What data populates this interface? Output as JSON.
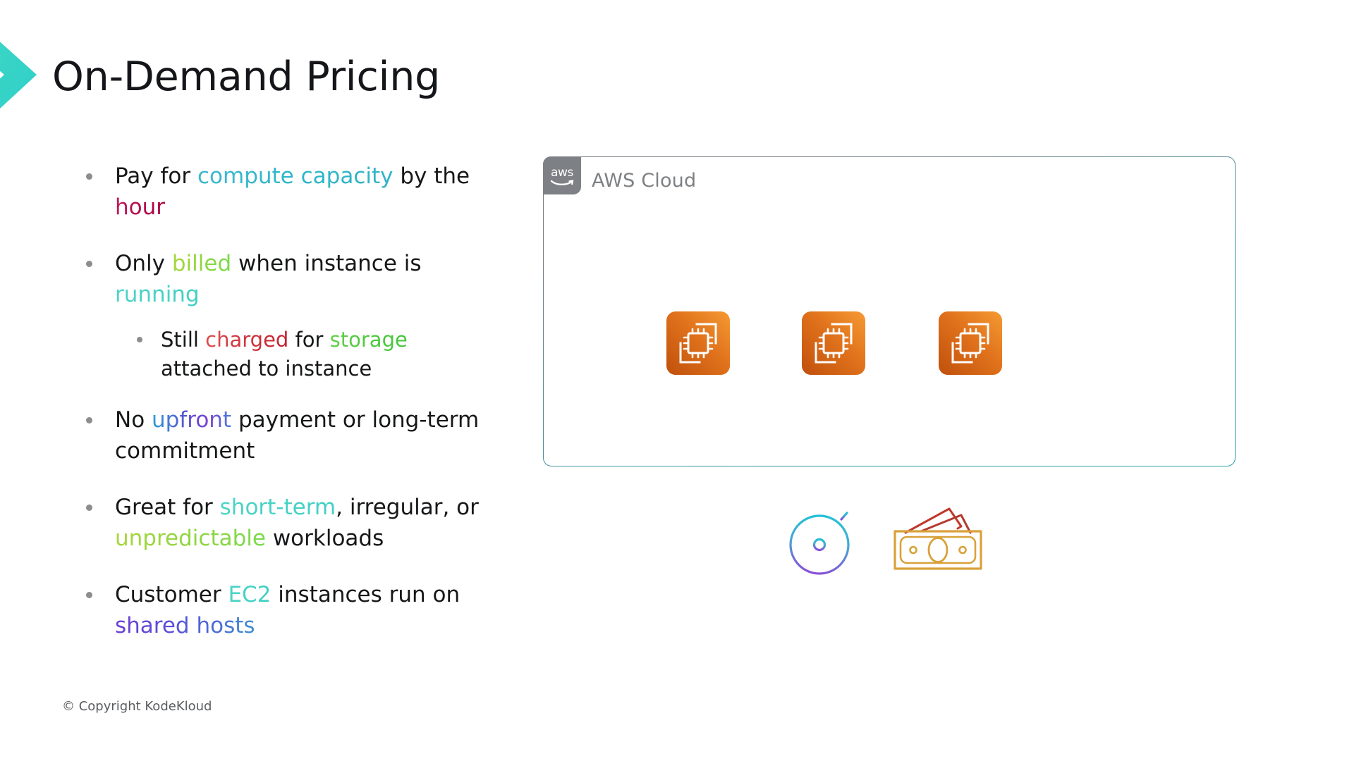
{
  "slide": {
    "title": "On-Demand Pricing",
    "copyright": "© Copyright KodeKloud"
  },
  "bullets": [
    {
      "level": 1,
      "segments": [
        {
          "text": "Pay for ",
          "style": "plain"
        },
        {
          "text": "compute capacity",
          "style": "cyan"
        },
        {
          "text": " by the ",
          "style": "plain"
        },
        {
          "text": "hour",
          "style": "crimson"
        }
      ]
    },
    {
      "level": 1,
      "segments": [
        {
          "text": "Only ",
          "style": "plain"
        },
        {
          "text": "billed",
          "style": "lime"
        },
        {
          "text": " when instance is ",
          "style": "plain"
        },
        {
          "text": "running",
          "style": "turquoise"
        }
      ]
    },
    {
      "level": 2,
      "segments": [
        {
          "text": "Still ",
          "style": "plain"
        },
        {
          "text": "charged",
          "style": "red"
        },
        {
          "text": " for ",
          "style": "plain"
        },
        {
          "text": "storage",
          "style": "green"
        },
        {
          "text": " attached to instance",
          "style": "plain"
        }
      ]
    },
    {
      "level": 1,
      "segments": [
        {
          "text": "No ",
          "style": "plain"
        },
        {
          "text": "upfront",
          "style": "blueviolet"
        },
        {
          "text": " payment or long-term commitment",
          "style": "plain"
        }
      ]
    },
    {
      "level": 1,
      "segments": [
        {
          "text": "Great for ",
          "style": "plain"
        },
        {
          "text": "short-term",
          "style": "turquoise"
        },
        {
          "text": ", irregular, or ",
          "style": "plain"
        },
        {
          "text": "unpredictable",
          "style": "lime"
        },
        {
          "text": " workloads",
          "style": "plain"
        }
      ]
    },
    {
      "level": 1,
      "segments": [
        {
          "text": "Customer ",
          "style": "plain"
        },
        {
          "text": "EC2",
          "style": "turquoise"
        },
        {
          "text": " instances run on ",
          "style": "plain"
        },
        {
          "text": "shared hosts",
          "style": "purple"
        }
      ]
    }
  ],
  "diagram": {
    "group_label": "AWS Cloud",
    "logo_text": "aws",
    "instances": [
      {
        "name": "ec2-instance-1"
      },
      {
        "name": "ec2-instance-2"
      },
      {
        "name": "ec2-instance-3"
      }
    ],
    "side_icons": [
      {
        "name": "stopwatch-icon"
      },
      {
        "name": "money-icon"
      }
    ]
  },
  "colors": {
    "accent_teal": "#3dd6c4",
    "box_border_teal": "#2aa0a6",
    "box_border_gray": "#7d8085",
    "aws_logo_gray": "#7d8084",
    "ec2_orange_dark": "#c8520e",
    "ec2_orange_light": "#f5922f",
    "title_text": "#15161a",
    "body_text": "#161718",
    "bullet_dot": "#8d8d8d",
    "money_gold": "#d9a13a",
    "money_red": "#c0392b",
    "stopwatch_cyan": "#2bb8d0",
    "stopwatch_purple": "#8a4fd8"
  }
}
